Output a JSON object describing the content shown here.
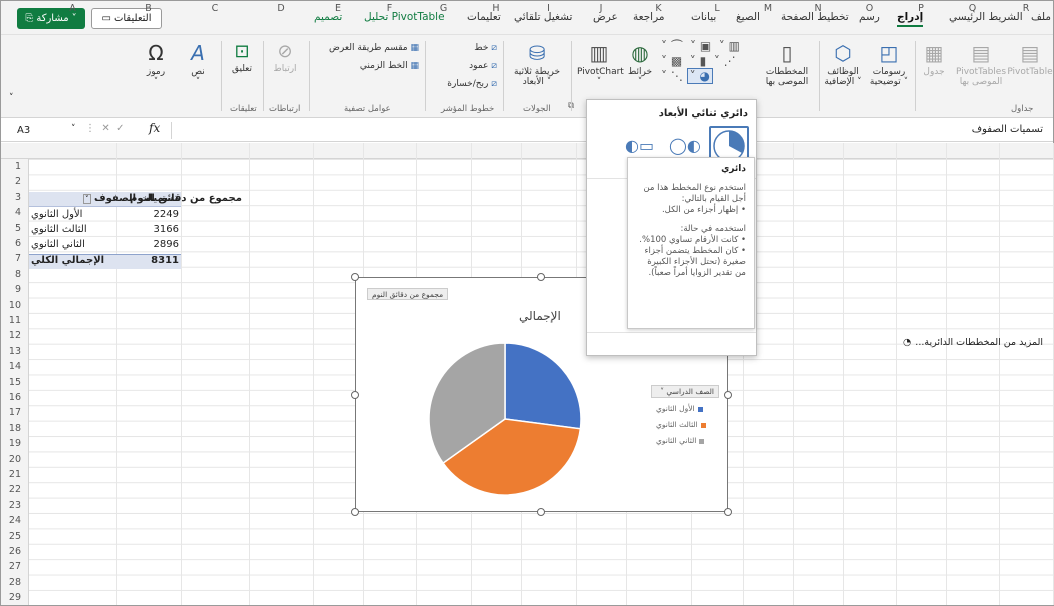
{
  "tabs": {
    "t1": "ملف",
    "t2": "الشريط الرئيسي",
    "t3": "إدراج",
    "t4": "رسم",
    "t5": "تخطيط الصفحة",
    "t6": "الصيغ",
    "t7": "بيانات",
    "t8": "مراجعة",
    "t9": "عرض",
    "t10": "تشغيل تلقائي",
    "t11": "تعليمات",
    "t12": "تحليل PivotTable",
    "t13": "تصميم"
  },
  "actions": {
    "comments": "التعليقات",
    "share": "مشاركة"
  },
  "ribbon": {
    "pivottable": "PivotTable",
    "rec_pivot": "PivotTables",
    "rec_pivot2": "الموصى بها",
    "table": "جدول",
    "tables_group": "جداول",
    "illustrations": "رسومات",
    "illustrations2": "توضيحية",
    "addins": "الوظائف",
    "addins2": "الإضافية",
    "rec_charts": "المخططات",
    "rec_charts2": "الموصى بها",
    "maps": "خرائط",
    "pivotchart": "PivotChart",
    "map3d": "خريطة ثلاثية",
    "map3d2": "الأبعاد",
    "tours_group": "الجولات",
    "line": "خط",
    "column": "عمود",
    "winloss": "ربح/خسارة",
    "sparklines_group": "خطوط المؤشر",
    "slicer": "مقسم طريقة العرض",
    "timeline": "الخط الزمني",
    "filters_group": "عوامل تصفية",
    "link": "ارتباط",
    "links_group": "ارتباطات",
    "comment": "تعليق",
    "comments_group": "تعليقات",
    "text": "نص",
    "symbols": "رموز"
  },
  "formula_bar": {
    "cell_ref": "A3",
    "value": "تسميات الصفوف"
  },
  "columns": [
    "A",
    "B",
    "C",
    "D",
    "E",
    "F",
    "G",
    "H",
    "I",
    "J",
    "K",
    "L",
    "M",
    "N",
    "O",
    "P",
    "Q",
    "R"
  ],
  "rows": [
    "1",
    "2",
    "3",
    "4",
    "5",
    "6",
    "7",
    "8",
    "9",
    "10",
    "11",
    "12",
    "13",
    "14",
    "15",
    "16",
    "17",
    "18",
    "19",
    "20",
    "21",
    "22",
    "23",
    "24",
    "25",
    "26",
    "27",
    "28",
    "29"
  ],
  "pivot": {
    "header_label": "تسميات الصفوف",
    "header_value": "مجموع من دقائق النوم",
    "rows": [
      {
        "label": "الأول الثانوي",
        "value": "2249"
      },
      {
        "label": "الثالث الثانوي",
        "value": "3166"
      },
      {
        "label": "الثاني الثانوي",
        "value": "2896"
      }
    ],
    "total_label": "الإجمالي الكلي",
    "total_value": "8311"
  },
  "chart": {
    "field_button": "مجموع من دقائق النوم",
    "title": "الإجمالي",
    "legend_title": "الصف الدراسي",
    "legend": [
      "الأول الثانوي",
      "الثالث الثانوي",
      "الثاني الثانوي"
    ]
  },
  "chart_data": {
    "type": "pie",
    "title": "الإجمالي",
    "categories": [
      "الأول الثانوي",
      "الثالث الثانوي",
      "الثاني الثانوي"
    ],
    "values": [
      2249,
      3166,
      2896
    ],
    "colors": [
      "#4472c4",
      "#ed7d31",
      "#a5a5a5"
    ],
    "legend_position": "right"
  },
  "dropdown": {
    "heading": "دائري ثنائي الأبعاد",
    "tooltip_title": "دائري",
    "tooltip_p1": "استخدم نوع المخطط هذا من أجل القيام بالتالي:",
    "tooltip_b1": "• إظهار أجزاء من الكل.",
    "tooltip_p2": "استخدمه في حالة:",
    "tooltip_b2": "• كانت الأرقام تساوي 100%.",
    "tooltip_b3": "• كان المخطط يتضمن أجزاء صغيرة (تحتل الأجزاء الكبيرة من تقدير الزوايا أمراً صعباً).",
    "more": "المزيد من المخططات الدائرية..."
  }
}
